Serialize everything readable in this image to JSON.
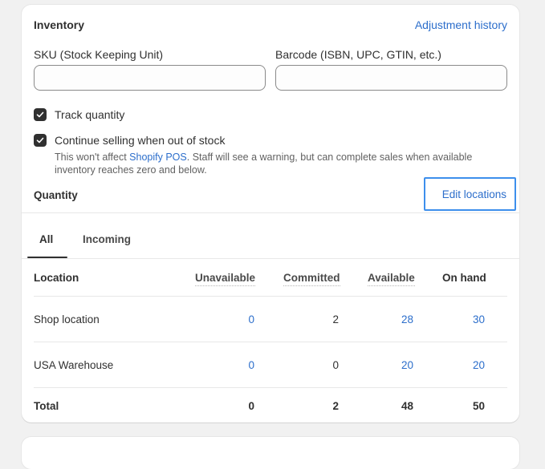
{
  "card": {
    "title": "Inventory",
    "adjustment_history": "Adjustment history",
    "sku": {
      "label": "SKU (Stock Keeping Unit)",
      "value": "",
      "placeholder": ""
    },
    "barcode": {
      "label": "Barcode (ISBN, UPC, GTIN, etc.)",
      "value": "",
      "placeholder": ""
    },
    "track_quantity": {
      "label": "Track quantity",
      "checked": true
    },
    "continue_selling": {
      "label": "Continue selling when out of stock",
      "checked": true,
      "helper_prefix": "This won't affect ",
      "helper_link": "Shopify POS",
      "helper_suffix": ". Staff will see a warning, but can complete sales when available inventory reaches zero and below."
    },
    "quantity_label": "Quantity",
    "edit_locations": "Edit locations"
  },
  "tabs": [
    {
      "label": "All",
      "active": true
    },
    {
      "label": "Incoming",
      "active": false
    }
  ],
  "table": {
    "headers": [
      "Location",
      "Unavailable",
      "Committed",
      "Available",
      "On hand"
    ],
    "rows": [
      {
        "location": "Shop location",
        "unavailable": "0",
        "committed": "2",
        "available": "28",
        "on_hand": "30"
      },
      {
        "location": "USA Warehouse",
        "unavailable": "0",
        "committed": "0",
        "available": "20",
        "on_hand": "20"
      }
    ],
    "total": {
      "label": "Total",
      "unavailable": "0",
      "committed": "2",
      "available": "48",
      "on_hand": "50"
    }
  },
  "colors": {
    "link": "#2c6ecb",
    "focus_ring": "#3d8fec",
    "checkbox": "#303030",
    "background": "#f1f1f1"
  }
}
